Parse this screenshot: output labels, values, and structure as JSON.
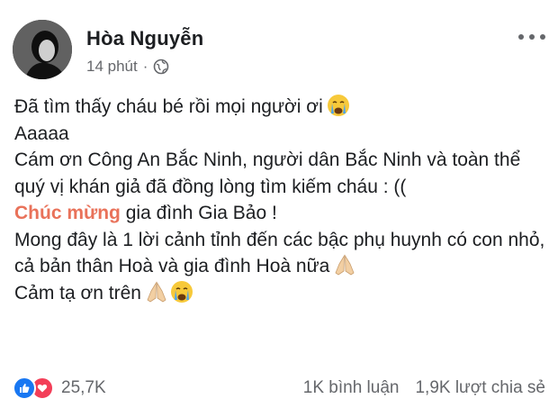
{
  "post": {
    "author": "Hòa Nguyễn",
    "time": "14 phút",
    "separator": "·",
    "privacy_icon": "globe-icon",
    "more_icon": "more-options-icon",
    "lines": [
      "Đã tìm thấy cháu bé rồi mọi người ơi",
      "Aaaaa",
      "Cám ơn Công An Bắc Ninh, người dân Bắc Ninh và toàn thể quý vị khán giả đã đồng lòng tìm kiếm cháu : ((",
      "gia đình Gia Bảo !",
      "Mong đây là 1 lời cảnh tỉnh đến các bậc phụ huynh có con nhỏ, cả bản thân Hoà và gia đình Hoà nữa",
      "Cảm tạ ơn trên"
    ],
    "highlight": "Chúc mừng",
    "emojis": [
      "crying-face-emoji",
      "folded-hands-emoji"
    ]
  },
  "footer": {
    "reaction_count": "25,7K",
    "comments": "1K bình luận",
    "shares": "1,9K lượt chia sẻ"
  },
  "colors": {
    "text": "#1c1e21",
    "secondary": "#65676b",
    "highlight": "#e9725a",
    "like_blue": "#1877f2",
    "love_red": "#f33e58"
  }
}
